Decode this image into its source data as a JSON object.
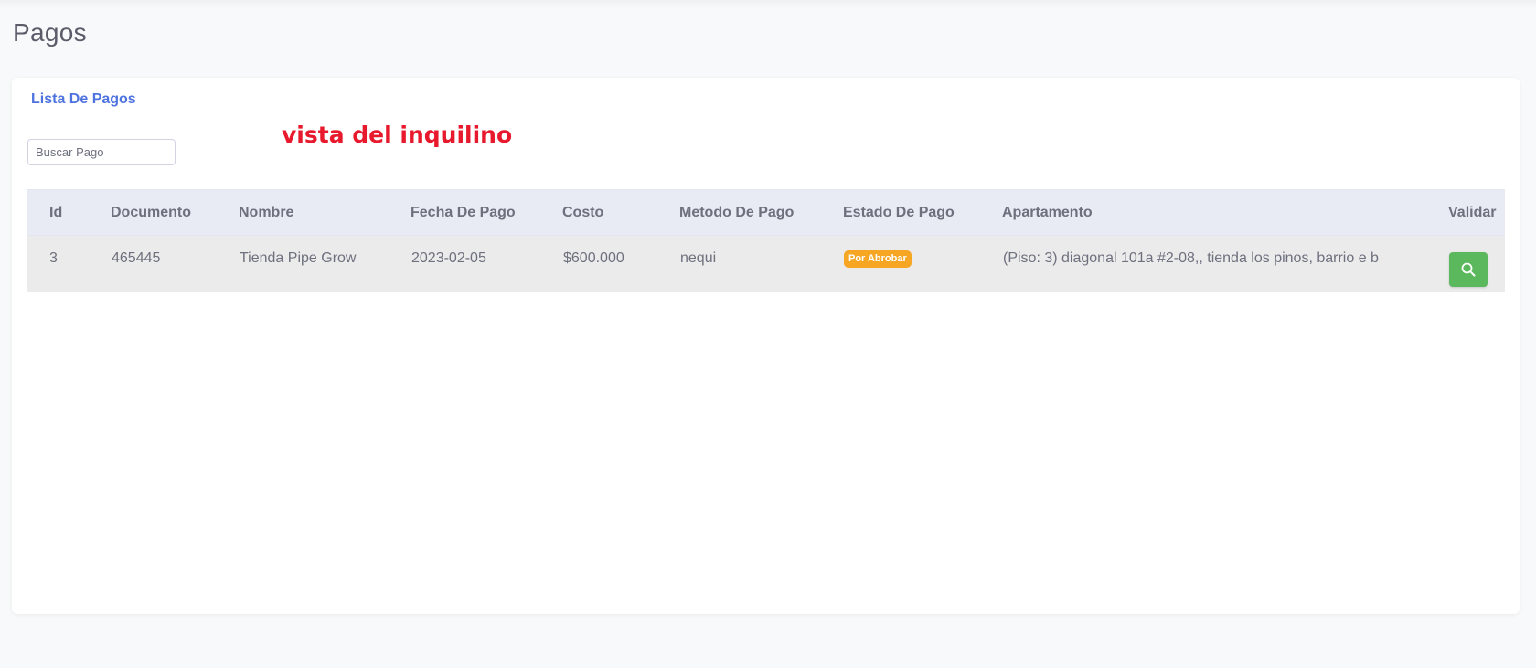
{
  "page": {
    "title": "Pagos"
  },
  "card": {
    "header": "Lista De Pagos",
    "annotation": "vista del inquilino"
  },
  "search": {
    "placeholder": "Buscar Pago",
    "value": ""
  },
  "table": {
    "columns": [
      "Id",
      "Documento",
      "Nombre",
      "Fecha De Pago",
      "Costo",
      "Metodo De Pago",
      "Estado De Pago",
      "Apartamento",
      "Validar"
    ],
    "rows": [
      {
        "id": "3",
        "documento": "465445",
        "nombre": "Tienda Pipe Grow",
        "fecha": "2023-02-05",
        "costo": "$600.000",
        "metodo": "nequi",
        "estado": "Por Abrobar",
        "apartamento": "(Piso: 3) diagonal 101a #2-08,, tienda los pinos, barrio e b",
        "validar_icon": "search-icon"
      }
    ]
  },
  "colors": {
    "accent": "#4e73df",
    "annotation": "#e8192c",
    "badge": "#f6a623",
    "button": "#5cb85c"
  }
}
